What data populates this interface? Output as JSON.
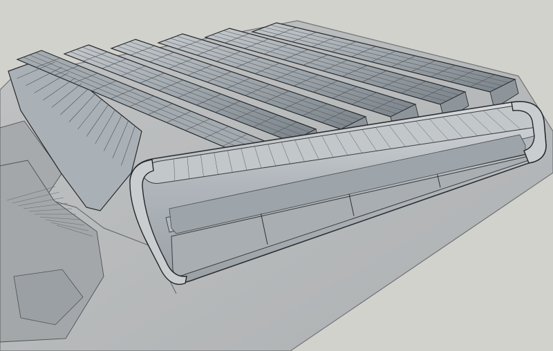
{
  "viewport": {
    "background_color": "#d2d2cd",
    "ground_color": "#b5b7b8",
    "ground_edge_color": "#6f7275",
    "line_color": "#2f3133",
    "glass_color": "#8f969c",
    "glass_light_color": "#b8bec3",
    "roof_dark_color": "#757c82"
  },
  "model": {
    "roof_count": 6,
    "tube_window_count": 3
  }
}
